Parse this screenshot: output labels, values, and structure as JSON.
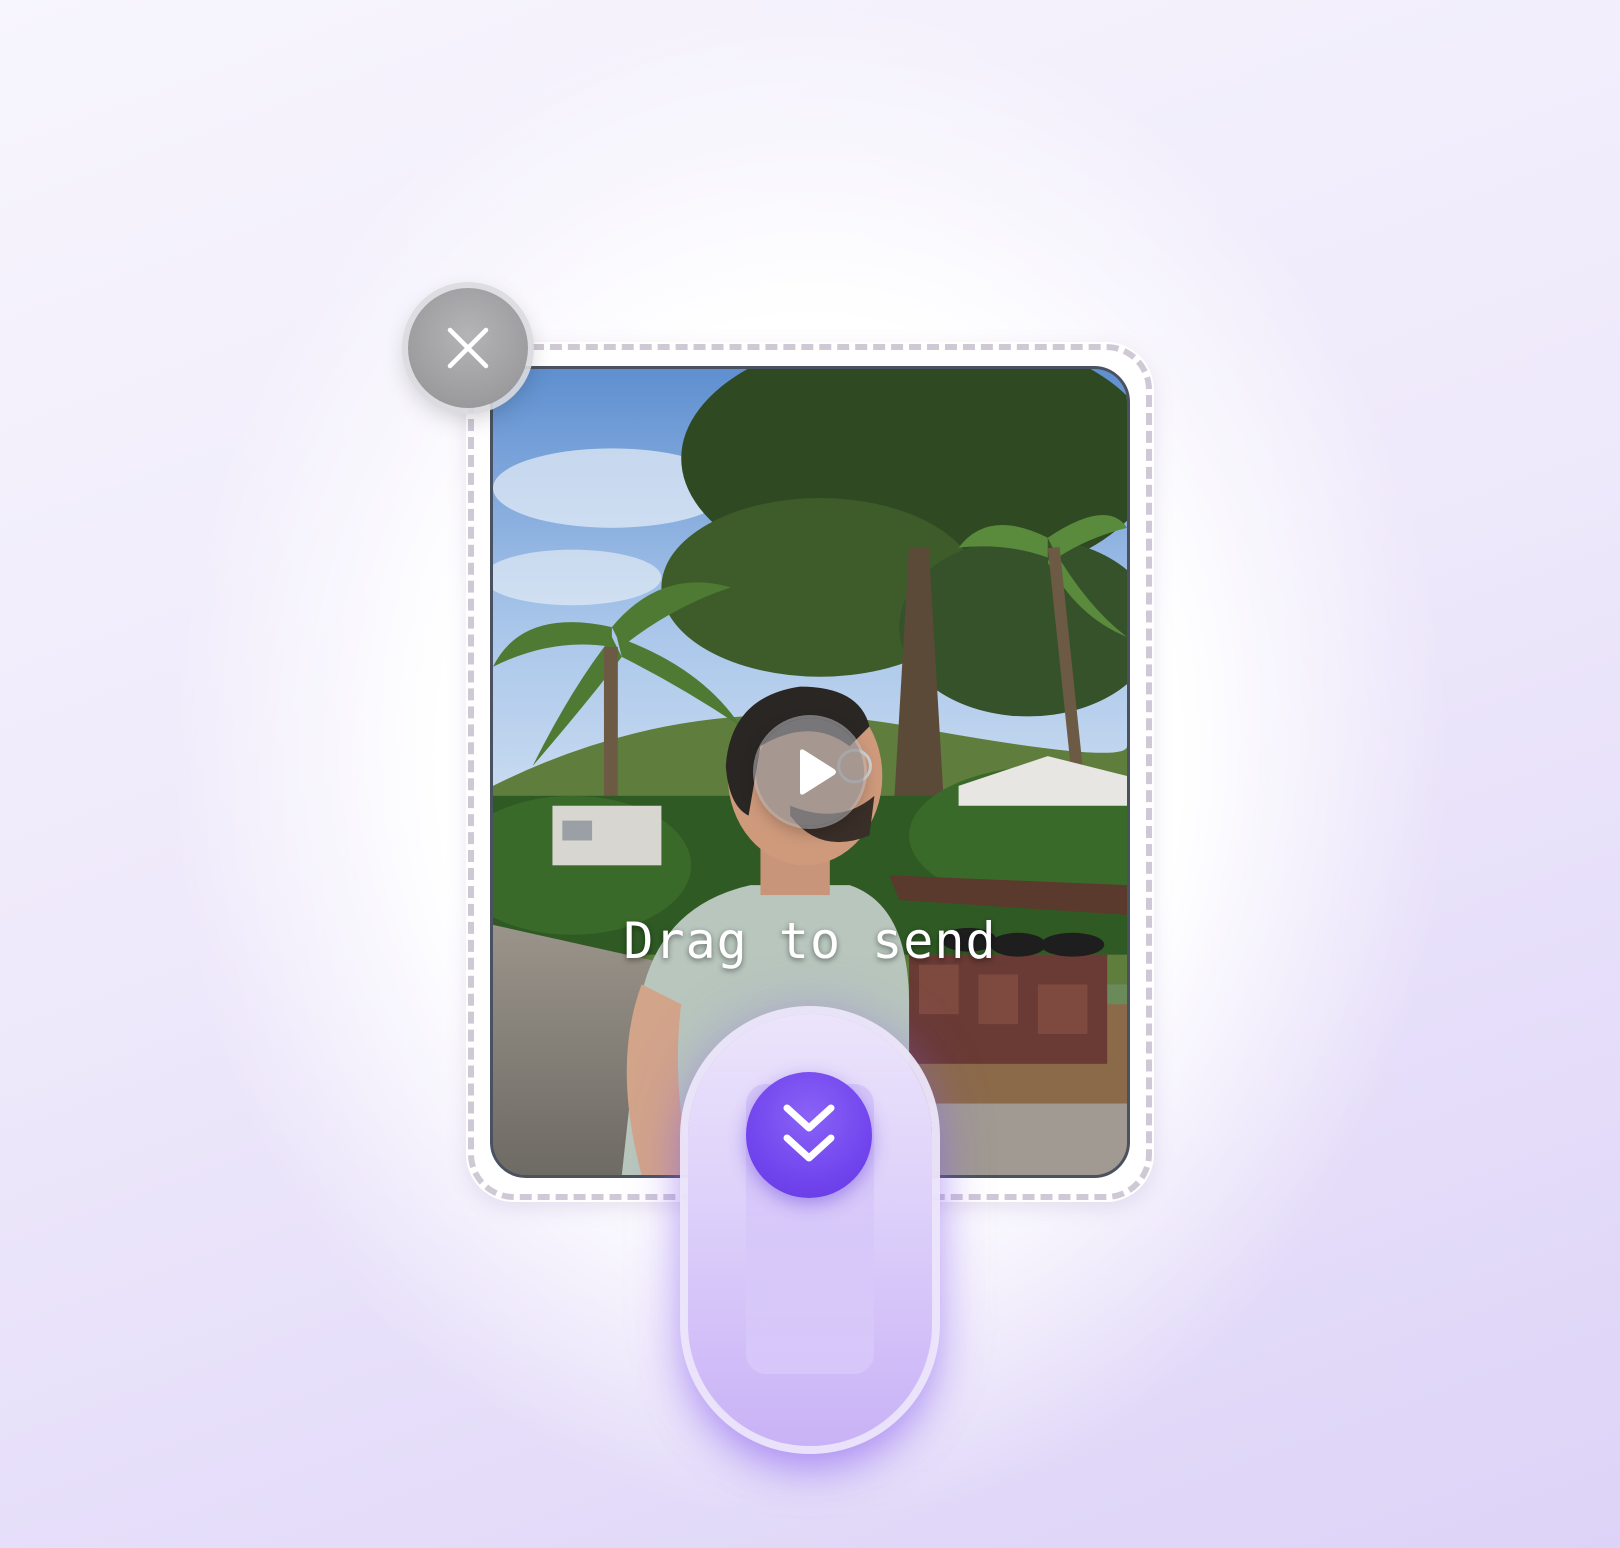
{
  "media": {
    "type": "video",
    "hint_text": "Drag to send"
  },
  "controls": {
    "close_icon": "close-icon",
    "play_icon": "play-icon",
    "slider_icon": "chevrons-down-icon"
  },
  "colors": {
    "accent": "#7246ee",
    "slider_light": "#ece4fb",
    "frame_dash": "#cfc9d6",
    "close_bg": "#a3a3a5"
  }
}
